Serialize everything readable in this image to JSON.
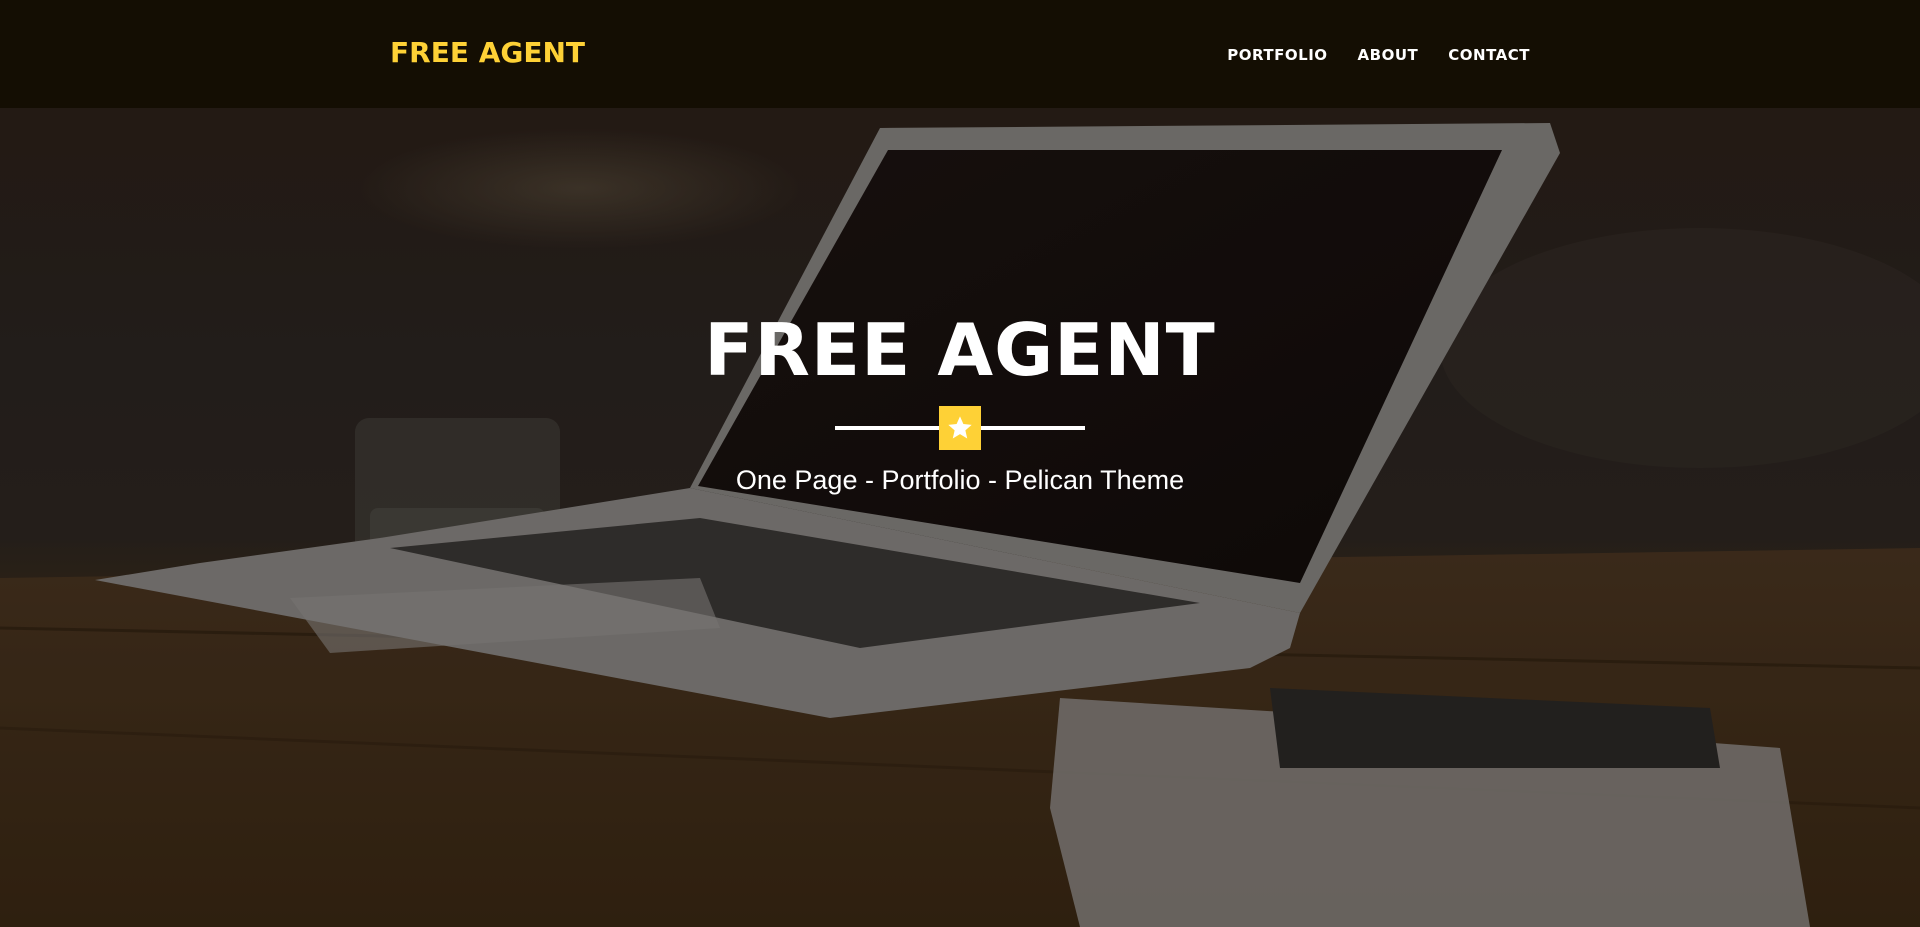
{
  "navbar": {
    "brand": "FREE AGENT",
    "links": [
      {
        "label": "PORTFOLIO"
      },
      {
        "label": "ABOUT"
      },
      {
        "label": "CONTACT"
      }
    ]
  },
  "hero": {
    "title": "FREE AGENT",
    "divider_icon": "star-icon",
    "subtitle": "One Page - Portfolio - Pelican Theme",
    "background_image": "laptop-on-wooden-desk-photo"
  },
  "colors": {
    "accent": "#fed136",
    "navbar_bg": "#140e03",
    "text": "#ffffff"
  }
}
